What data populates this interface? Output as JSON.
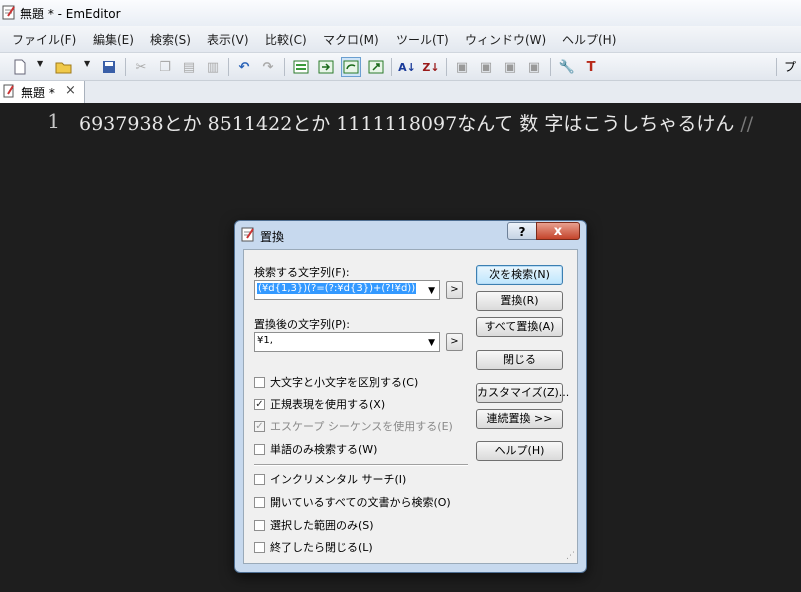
{
  "window": {
    "title": "無題 * - EmEditor"
  },
  "menu": [
    "ファイル(F)",
    "編集(E)",
    "検索(S)",
    "表示(V)",
    "比較(C)",
    "マクロ(M)",
    "ツール(T)",
    "ウィンドウ(W)",
    "ヘルプ(H)"
  ],
  "toolbar": {
    "right_label": "プ"
  },
  "tab": {
    "label": "無題 *",
    "close": "×"
  },
  "editor": {
    "line_number": "1",
    "text": "6937938とか 8511422とか 1111118097なんて 数 字はこうしちゃるけん",
    "eol_mark": "//"
  },
  "dialog": {
    "title": "置換",
    "help_button": "?",
    "close_button": "x",
    "find_label": "検索する文字列(F):",
    "find_value": "(¥d{1,3})(?=(?:¥d{3})+(?!¥d))",
    "replace_label": "置換後の文字列(P):",
    "replace_value": "¥1,",
    "arrow_button": ">",
    "buttons": {
      "find_next": "次を検索(N)",
      "replace": "置換(R)",
      "replace_all": "すべて置換(A)",
      "close": "閉じる",
      "customize": "カスタマイズ(Z)...",
      "batch_replace": "連続置換 >>",
      "help": "ヘルプ(H)"
    },
    "options": [
      {
        "label": "大文字と小文字を区別する(C)",
        "checked": false,
        "disabled": false
      },
      {
        "label": "正規表現を使用する(X)",
        "checked": true,
        "disabled": false
      },
      {
        "label": "エスケープ シーケンスを使用する(E)",
        "checked": true,
        "disabled": true
      },
      {
        "label": "単語のみ検索する(W)",
        "checked": false,
        "disabled": false
      }
    ],
    "options2": [
      {
        "label": "インクリメンタル サーチ(I)",
        "checked": false
      },
      {
        "label": "開いているすべての文書から検索(O)",
        "checked": false
      },
      {
        "label": "選択した範囲のみ(S)",
        "checked": false
      },
      {
        "label": "終了したら閉じる(L)",
        "checked": false
      }
    ],
    "check_mark": "✓"
  },
  "colors": {
    "editor_bg": "#1e1e1e",
    "selection": "#3399ff",
    "close_red": "#c4442b"
  }
}
